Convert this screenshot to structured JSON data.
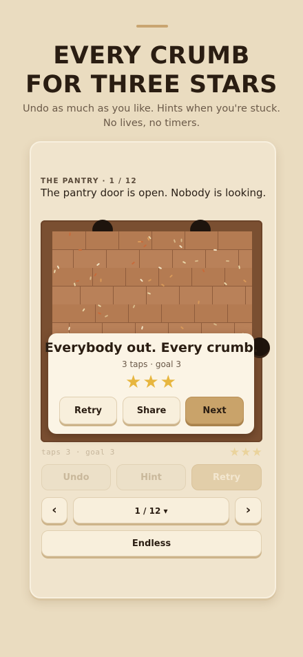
{
  "header": {
    "headline_line1": "EVERY CRUMB",
    "headline_line2": "FOR THREE STARS",
    "subhead": "Undo as much as you like. Hints when you're stuck. No lives, no timers."
  },
  "level": {
    "tag": "THE PANTRY · 1 / 12",
    "description": "The pantry door is open. Nobody is looking."
  },
  "result_dialog": {
    "title": "Everybody out. Every crumb.",
    "summary": "3 taps · goal 3",
    "stars_earned": 3,
    "stars_text": "★★★",
    "buttons": {
      "retry": "Retry",
      "share": "Share",
      "next": "Next"
    }
  },
  "status": {
    "stats_text": "taps 3 · goal 3",
    "stars_text": "★★★"
  },
  "controls": {
    "undo": "Undo",
    "hint": "Hint",
    "retry": "Retry",
    "prev_icon": "‹",
    "next_icon": "›",
    "level_picker": "1 / 12 ▾",
    "endless": "Endless"
  },
  "colors": {
    "background": "#eadcc0",
    "accent_gold": "#c9a36a",
    "star": "#e7b63f",
    "board_frame": "#7a4f31",
    "floor": "#b77e55"
  }
}
